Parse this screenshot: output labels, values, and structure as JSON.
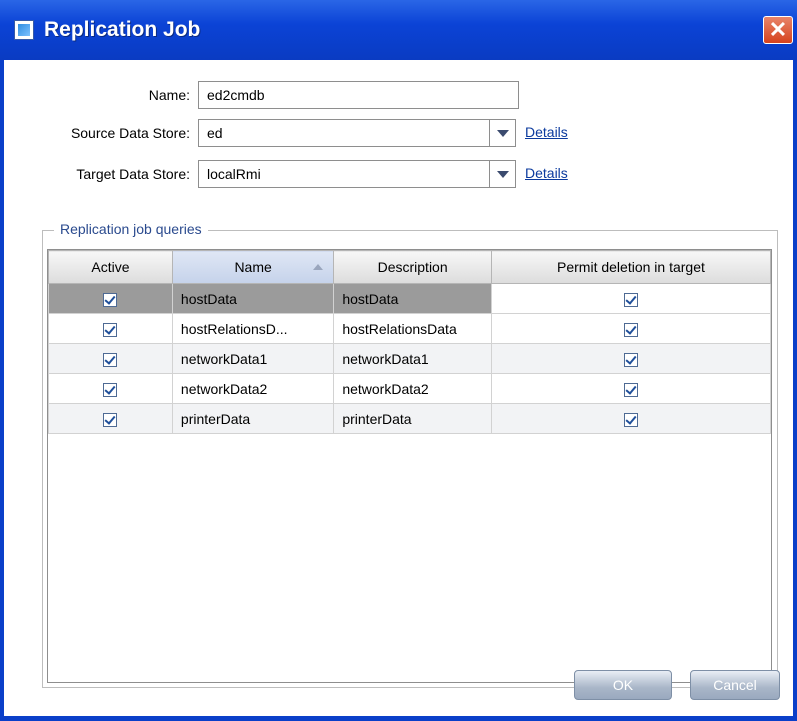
{
  "window": {
    "title": "Replication Job",
    "close_glyph": "✕"
  },
  "form": {
    "name_label": "Name:",
    "name_value": "ed2cmdb",
    "source_label": "Source Data Store:",
    "source_value": "ed",
    "target_label": "Target Data Store:",
    "target_value": "localRmi",
    "details_label": "Details"
  },
  "queries": {
    "group_title": "Replication job queries",
    "columns": [
      "Active",
      "Name",
      "Description",
      "Permit deletion in target"
    ],
    "rows": [
      {
        "active": true,
        "name": "hostData",
        "description": "hostData",
        "permit": true
      },
      {
        "active": true,
        "name": "hostRelationsD...",
        "description": "hostRelationsData",
        "permit": true
      },
      {
        "active": true,
        "name": "networkData1",
        "description": "networkData1",
        "permit": true
      },
      {
        "active": true,
        "name": "networkData2",
        "description": "networkData2",
        "permit": true
      },
      {
        "active": true,
        "name": "printerData",
        "description": "printerData",
        "permit": true
      }
    ],
    "sorted_column": "Name",
    "selected_row": 0
  },
  "buttons": {
    "ok": "OK",
    "cancel": "Cancel"
  },
  "colors": {
    "titlebar": "#0a3bc2",
    "link": "#0b3a9e",
    "selection": "#9b9b9b"
  },
  "icons": {
    "title": "app-window-icon",
    "close": "close-icon",
    "dropdown": "chevron-down-icon",
    "sort": "sort-ascending-icon",
    "check": "checkbox-checked-icon"
  }
}
